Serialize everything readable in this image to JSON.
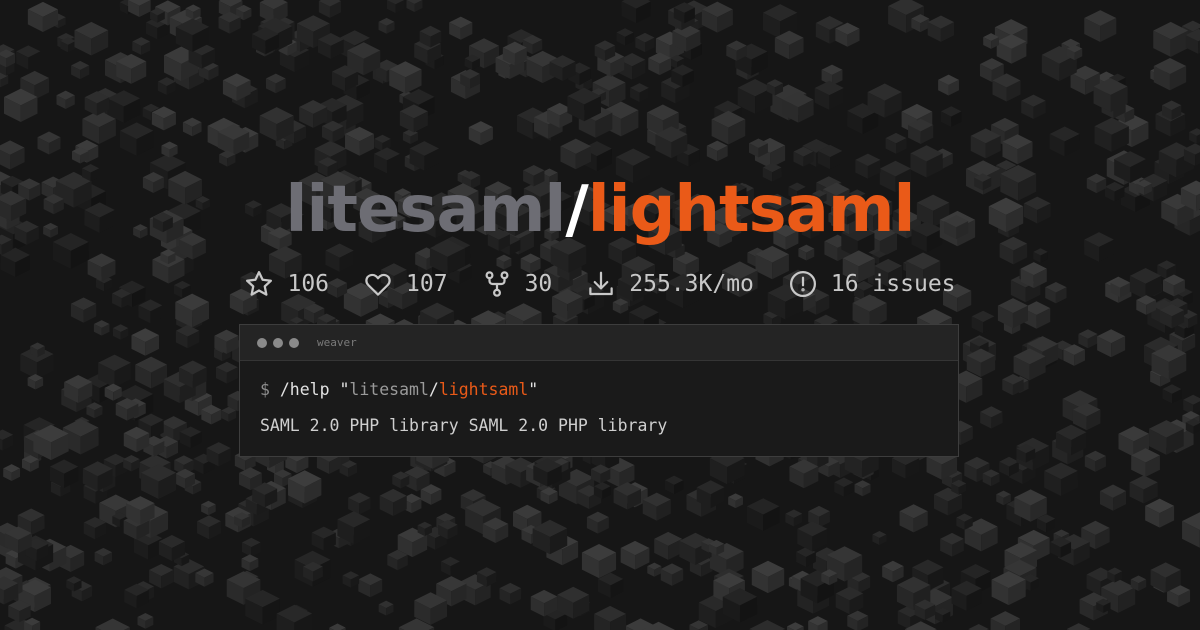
{
  "colors": {
    "background": "#161616",
    "owner": "#6d6d74",
    "slash": "#ffffff",
    "accent": "#ea5a18",
    "stat_text": "#c8c8c8"
  },
  "header": {
    "owner": "litesaml",
    "separator": "/",
    "repo": "lightsaml"
  },
  "stats": [
    {
      "icon": "star-icon",
      "value": "106"
    },
    {
      "icon": "heart-icon",
      "value": "107"
    },
    {
      "icon": "fork-icon",
      "value": "30"
    },
    {
      "icon": "download-icon",
      "value": "255.3K/mo"
    },
    {
      "icon": "alert-circle-icon",
      "value": "16 issues"
    }
  ],
  "terminal": {
    "title": "weaver",
    "prompt": "$",
    "command": "/help",
    "quote": "\"",
    "arg_owner": "litesaml",
    "arg_separator": "/",
    "arg_repo": "lightsaml",
    "output": "SAML 2.0 PHP library SAML 2.0 PHP library"
  }
}
